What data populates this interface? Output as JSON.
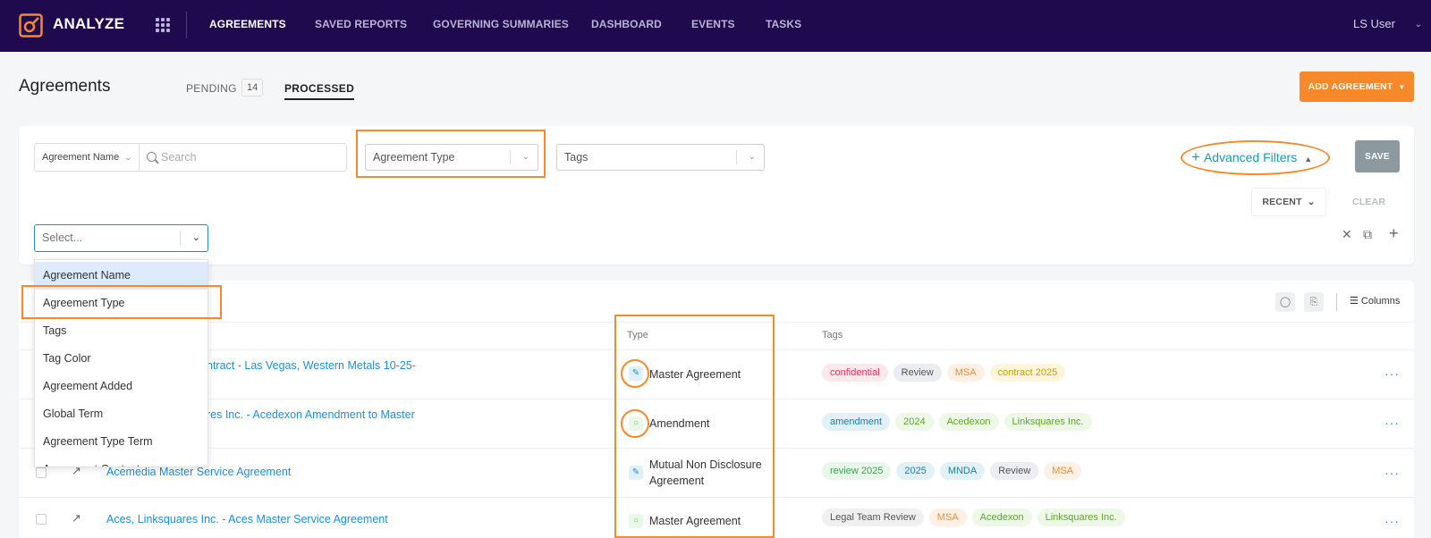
{
  "nav": {
    "brand": "ANALYZE",
    "items": [
      "AGREEMENTS",
      "SAVED REPORTS",
      "GOVERNING SUMMARIES",
      "DASHBOARD",
      "EVENTS",
      "TASKS"
    ],
    "user": "LS User"
  },
  "header": {
    "title": "Agreements",
    "tab_pending": "PENDING",
    "pending_count": "14",
    "tab_processed": "PROCESSED",
    "add_button": "ADD AGREEMENT"
  },
  "filters": {
    "field_select": "Agreement Name",
    "search_placeholder": "Search",
    "agreement_type_placeholder": "Agreement Type",
    "tags_placeholder": "Tags",
    "advanced_filters": "Advanced Filters",
    "save": "SAVE",
    "recent": "RECENT",
    "clear": "CLEAR",
    "select_placeholder": "Select..."
  },
  "menu": {
    "items": [
      "Agreement Name",
      "Agreement Type",
      "Tags",
      "Tag Color",
      "Agreement Added",
      "Global Term",
      "Agreement Type Term",
      "Agreement Content"
    ]
  },
  "table": {
    "columns_button": "Columns",
    "headers": {
      "type": "Type",
      "tags": "Tags"
    },
    "rows": [
      {
        "name": "ntract - Las Vegas, Western Metals 10-25-",
        "type": "Master Agreement",
        "type_icon": "pencil-icon",
        "tags": [
          {
            "label": "confidential",
            "bg": "#fde8ec",
            "fg": "#d6345a"
          },
          {
            "label": "Review",
            "bg": "#ececf3",
            "fg": "#555"
          },
          {
            "label": "MSA",
            "bg": "#fff0e6",
            "fg": "#f7892b"
          },
          {
            "label": "contract 2025",
            "bg": "#fdf6dd",
            "fg": "#c59a06"
          }
        ]
      },
      {
        "name": "res Inc. - Acedexon Amendment to Master",
        "type": "Amendment",
        "type_icon": "lightbulb-icon",
        "tags": [
          {
            "label": "amendment",
            "bg": "#e2f1f7",
            "fg": "#1c7ea0"
          },
          {
            "label": "2024",
            "bg": "#eef8e6",
            "fg": "#5da52d"
          },
          {
            "label": "Acedexon",
            "bg": "#eef8e6",
            "fg": "#5da52d"
          },
          {
            "label": "Linksquares Inc.",
            "bg": "#eef8e6",
            "fg": "#5da52d"
          }
        ]
      },
      {
        "name": "Acemedia Master Service Agreement",
        "type": "Mutual Non Disclosure Agreement",
        "type_icon": "pencil-icon",
        "tags": [
          {
            "label": "review 2025",
            "bg": "#e8f7ea",
            "fg": "#3ea055"
          },
          {
            "label": "2025",
            "bg": "#e2f1f7",
            "fg": "#1c7ea0"
          },
          {
            "label": "MNDA",
            "bg": "#e2f1f7",
            "fg": "#1c7ea0"
          },
          {
            "label": "Review",
            "bg": "#ececf3",
            "fg": "#555"
          },
          {
            "label": "MSA",
            "bg": "#fff0e6",
            "fg": "#f7892b"
          }
        ]
      },
      {
        "name": "Aces, Linksquares Inc. - Aces Master Service Agreement",
        "type": "Master Agreement",
        "type_icon": "lightbulb-icon",
        "tags": [
          {
            "label": "Legal Team Review",
            "bg": "#f0f0f0",
            "fg": "#555"
          },
          {
            "label": "MSA",
            "bg": "#fff0e6",
            "fg": "#f7892b"
          },
          {
            "label": "Acedexon",
            "bg": "#eef8e6",
            "fg": "#5da52d"
          },
          {
            "label": "Linksquares Inc.",
            "bg": "#eef8e6",
            "fg": "#5da52d"
          }
        ]
      }
    ]
  }
}
